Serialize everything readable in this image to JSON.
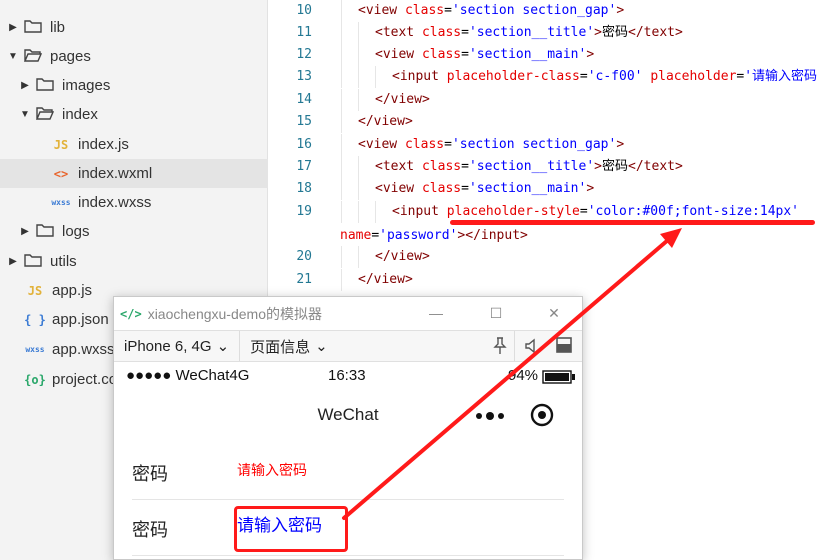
{
  "file_tree": [
    {
      "label": "lib",
      "kind": "folder",
      "expanded": false
    },
    {
      "label": "pages",
      "kind": "folder",
      "expanded": true
    },
    {
      "label": "images",
      "kind": "folder",
      "expanded": false
    },
    {
      "label": "index",
      "kind": "folder",
      "expanded": true
    },
    {
      "label": "index.js",
      "kind": "js",
      "icon_text": "JS"
    },
    {
      "label": "index.wxml",
      "kind": "wxml",
      "icon_text": "<>",
      "selected": true
    },
    {
      "label": "index.wxss",
      "kind": "wxss",
      "icon_text": "wxss"
    },
    {
      "label": "logs",
      "kind": "folder",
      "expanded": false
    },
    {
      "label": "utils",
      "kind": "folder",
      "expanded": false
    },
    {
      "label": "app.js",
      "kind": "js",
      "icon_text": "JS"
    },
    {
      "label": "app.json",
      "kind": "json",
      "icon_text": "{ }"
    },
    {
      "label": "app.wxss",
      "kind": "wxss",
      "icon_text": "wxss"
    },
    {
      "label": "project.config.json",
      "kind": "config",
      "icon_text": "{o}"
    }
  ],
  "code_lines": [
    {
      "num": "10",
      "segments": [
        [
          "p",
          "<"
        ],
        [
          "t",
          "view "
        ],
        [
          "a",
          "class"
        ],
        [
          "tx",
          "="
        ],
        [
          "v",
          "'section section_gap'"
        ],
        [
          "p",
          ">"
        ]
      ]
    },
    {
      "num": "11",
      "segments": [
        [
          "p",
          "<"
        ],
        [
          "t",
          "text "
        ],
        [
          "a",
          "class"
        ],
        [
          "tx",
          "="
        ],
        [
          "v",
          "'section__title'"
        ],
        [
          "p",
          ">"
        ],
        [
          "tx",
          "密码"
        ],
        [
          "p",
          "</"
        ],
        [
          "t",
          "text"
        ],
        [
          "p",
          ">"
        ]
      ]
    },
    {
      "num": "12",
      "segments": [
        [
          "p",
          "<"
        ],
        [
          "t",
          "view "
        ],
        [
          "a",
          "class"
        ],
        [
          "tx",
          "="
        ],
        [
          "v",
          "'section__main'"
        ],
        [
          "p",
          ">"
        ]
      ]
    },
    {
      "num": "13",
      "segments": [
        [
          "p",
          "<"
        ],
        [
          "t",
          "input "
        ],
        [
          "a",
          "placeholder-class"
        ],
        [
          "tx",
          "="
        ],
        [
          "v",
          "'c-f00'"
        ],
        [
          "tx",
          " "
        ],
        [
          "a",
          "placeholder"
        ],
        [
          "tx",
          "="
        ],
        [
          "v",
          "'请输入密码'"
        ]
      ]
    },
    {
      "num": "14",
      "segments": [
        [
          "p",
          "</"
        ],
        [
          "t",
          "view"
        ],
        [
          "p",
          ">"
        ]
      ]
    },
    {
      "num": "15",
      "segments": [
        [
          "p",
          "</"
        ],
        [
          "t",
          "view"
        ],
        [
          "p",
          ">"
        ]
      ]
    },
    {
      "num": "16",
      "segments": [
        [
          "p",
          "<"
        ],
        [
          "t",
          "view "
        ],
        [
          "a",
          "class"
        ],
        [
          "tx",
          "="
        ],
        [
          "v",
          "'section section_gap'"
        ],
        [
          "p",
          ">"
        ]
      ]
    },
    {
      "num": "17",
      "segments": [
        [
          "p",
          "<"
        ],
        [
          "t",
          "text "
        ],
        [
          "a",
          "class"
        ],
        [
          "tx",
          "="
        ],
        [
          "v",
          "'section__title'"
        ],
        [
          "p",
          ">"
        ],
        [
          "tx",
          "密码"
        ],
        [
          "p",
          "</"
        ],
        [
          "t",
          "text"
        ],
        [
          "p",
          ">"
        ]
      ]
    },
    {
      "num": "18",
      "segments": [
        [
          "p",
          "<"
        ],
        [
          "t",
          "view "
        ],
        [
          "a",
          "class"
        ],
        [
          "tx",
          "="
        ],
        [
          "v",
          "'section__main'"
        ],
        [
          "p",
          ">"
        ]
      ]
    },
    {
      "num": "19",
      "segments": [
        [
          "p",
          "<"
        ],
        [
          "t",
          "input "
        ],
        [
          "a",
          "placeholder-style"
        ],
        [
          "tx",
          "="
        ],
        [
          "v",
          "'color:#00f;font-size:14px'"
        ]
      ]
    },
    {
      "num": "",
      "segments": [
        [
          "a",
          "name"
        ],
        [
          "tx",
          "="
        ],
        [
          "v",
          "'password'"
        ],
        [
          "p",
          "></"
        ],
        [
          "t",
          "input"
        ],
        [
          "p",
          ">"
        ]
      ]
    },
    {
      "num": "20",
      "segments": [
        [
          "p",
          "</"
        ],
        [
          "t",
          "view"
        ],
        [
          "p",
          ">"
        ]
      ]
    },
    {
      "num": "21",
      "segments": [
        [
          "p",
          "</"
        ],
        [
          "t",
          "view"
        ],
        [
          "p",
          ">"
        ]
      ]
    }
  ],
  "simulator": {
    "logo_text": "</>",
    "window_title": "xiaochengxu-demo的模拟器",
    "minimize_symbol": "—",
    "maximize_symbol": "☐",
    "close_symbol": "✕",
    "device_select": "iPhone 6, 4G",
    "page_info_select": "页面信息",
    "dropdown_arrow": "⌄",
    "status_signal": "●●●●● WeChat4G",
    "status_time": "16:33",
    "status_battery": "94%",
    "nav_title": "WeChat",
    "rows": [
      {
        "label": "密码",
        "placeholder": "请输入密码"
      },
      {
        "label": "密码",
        "placeholder": "请输入密码"
      }
    ]
  },
  "colors": {
    "annotation_red": "#ff1a1a",
    "placeholder_red": "#ff0000",
    "placeholder_blue": "#0000ff"
  }
}
